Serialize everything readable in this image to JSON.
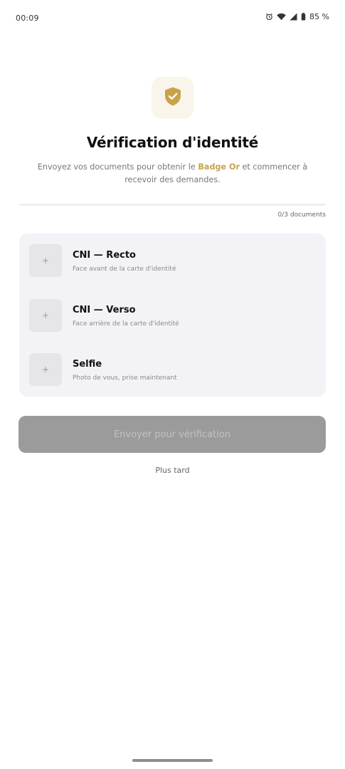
{
  "status_bar": {
    "time": "00:09",
    "battery": "85 %"
  },
  "header": {
    "title": "Vérification d'identité",
    "subtitle_before": "Envoyez vos documents pour obtenir le ",
    "subtitle_highlight": "Badge Or",
    "subtitle_after": " et commencer à recevoir des demandes."
  },
  "progress": {
    "label": "0/3 documents",
    "fraction": 0
  },
  "documents": [
    {
      "title": "CNI — Recto",
      "description": "Face avant de la carte d'identité",
      "add_symbol": "+"
    },
    {
      "title": "CNI — Verso",
      "description": "Face arrière de la carte d'identité",
      "add_symbol": "+"
    },
    {
      "title": "Selfie",
      "description": "Photo de vous, prise maintenant",
      "add_symbol": "+"
    }
  ],
  "actions": {
    "submit_label": "Envoyer pour vérification",
    "later_label": "Plus tard"
  },
  "colors": {
    "accent_gold": "#c9a24b",
    "disabled_button": "#9b9b9b"
  }
}
